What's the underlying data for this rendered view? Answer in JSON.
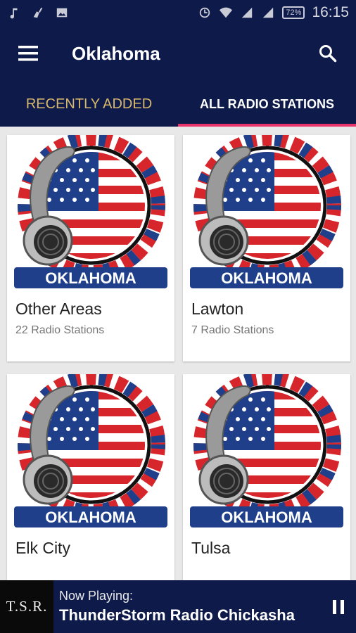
{
  "status_bar": {
    "battery": "72%",
    "time": "16:15",
    "icons": [
      "music-icon",
      "broom-icon",
      "image-icon",
      "sync-icon",
      "wifi-icon",
      "signal-icon",
      "signal-icon"
    ]
  },
  "app_bar": {
    "title": "Oklahoma",
    "menu_icon": "menu-icon",
    "search_icon": "search-icon"
  },
  "tabs": [
    {
      "label": "RECENTLY ADDED",
      "active": false
    },
    {
      "label": "ALL RADIO STATIONS",
      "active": true
    }
  ],
  "cards": [
    {
      "image_label": "OKLAHOMA",
      "title": "Other Areas",
      "subtitle": "22 Radio Stations"
    },
    {
      "image_label": "OKLAHOMA",
      "title": "Lawton",
      "subtitle": "7 Radio Stations"
    },
    {
      "image_label": "OKLAHOMA",
      "title": "Elk City",
      "subtitle": ""
    },
    {
      "image_label": "OKLAHOMA",
      "title": "Tulsa",
      "subtitle": ""
    }
  ],
  "now_playing": {
    "logo_text": "T.S.R.",
    "label": "Now Playing:",
    "station": "ThunderStorm Radio Chickasha",
    "control_icon": "pause-icon"
  },
  "colors": {
    "primary": "#0e1a4a",
    "accent": "#e8336b",
    "tab_inactive": "#d8b86a"
  }
}
